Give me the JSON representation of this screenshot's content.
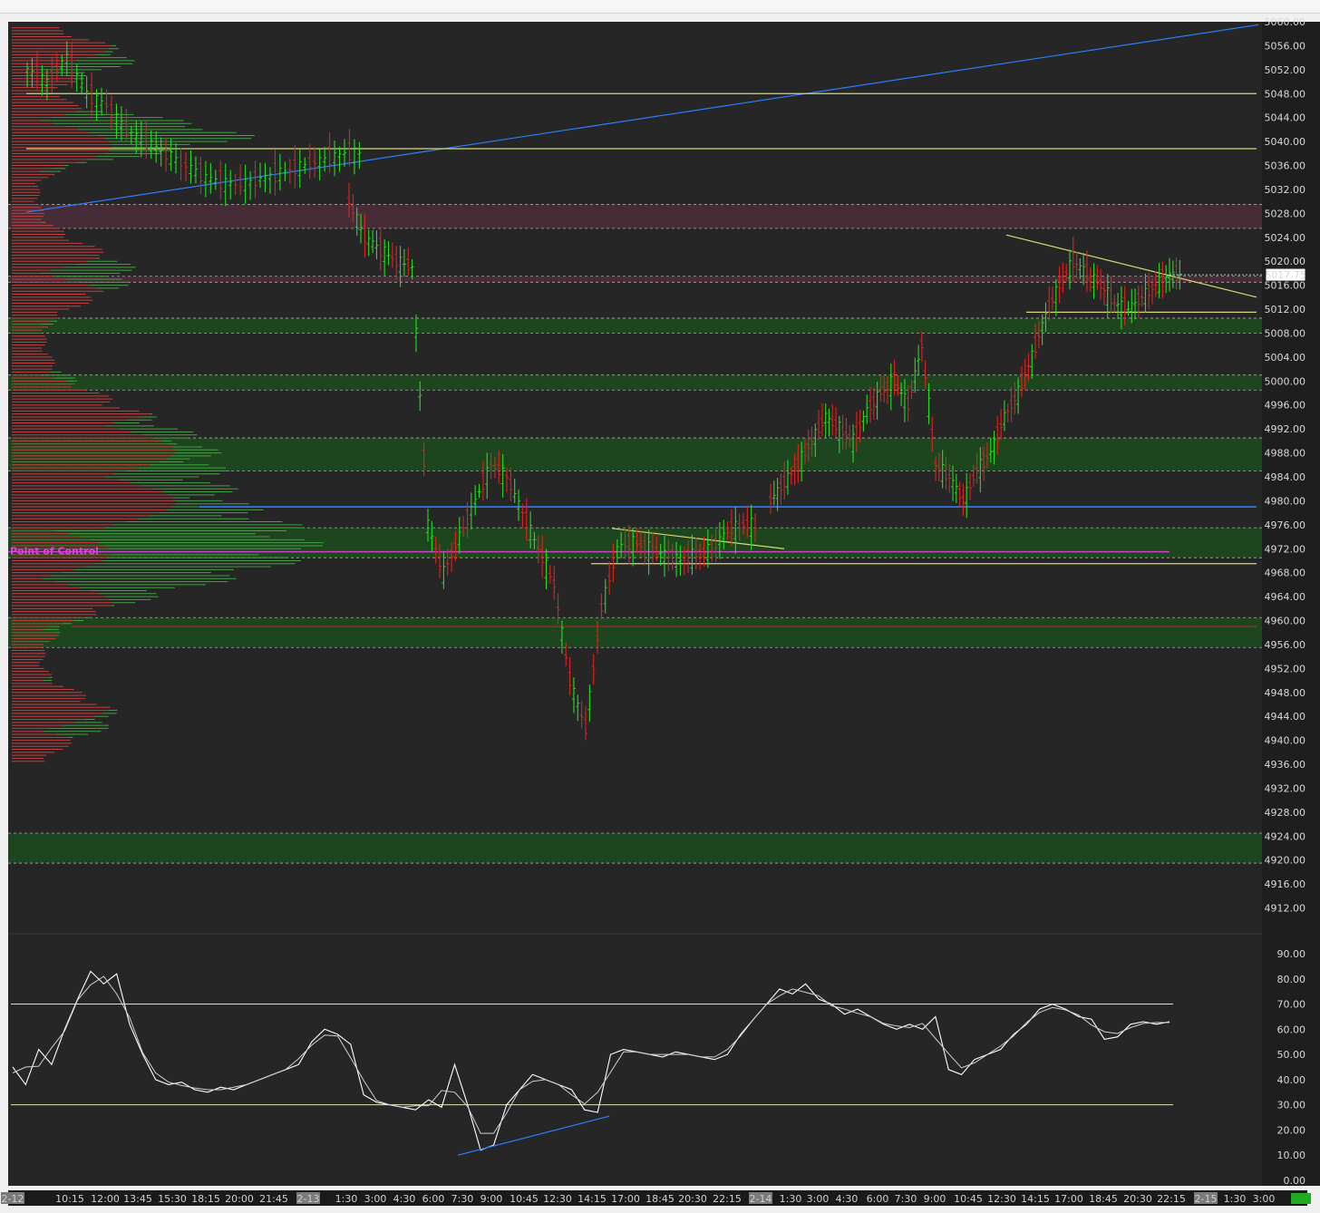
{
  "window": {
    "title": ""
  },
  "colors": {
    "background": "#262626",
    "up_bar": "#22dd22",
    "down_bar": "#dd2222",
    "zone_green": "#1e4a1e",
    "zone_purple": "#4a2e3a",
    "yellow_line": "#d8d870",
    "blue_line": "#2a7fff",
    "poc_line": "#cc44cc",
    "red_level": "#bb2222"
  },
  "chart_data": [
    {
      "type": "line",
      "name": "price-panel",
      "title": "",
      "ylim": [
        4908,
        5060
      ],
      "y_ticks": [
        "5060.00",
        "5056.00",
        "5052.00",
        "5048.00",
        "5044.00",
        "5040.00",
        "5036.00",
        "5032.00",
        "5028.00",
        "5024.00",
        "5020.00",
        "5016.00",
        "5012.00",
        "5008.00",
        "5004.00",
        "5000.00",
        "4996.00",
        "4992.00",
        "4988.00",
        "4984.00",
        "4980.00",
        "4976.00",
        "4972.00",
        "4968.00",
        "4964.00",
        "4960.00",
        "4956.00",
        "4952.00",
        "4948.00",
        "4944.00",
        "4940.00",
        "4936.00",
        "4932.00",
        "4928.00",
        "4924.00",
        "4920.00",
        "4916.00",
        "4912.00"
      ],
      "last_price": "5017.75",
      "poc_label": "Point of Control",
      "poc_price": 4971.5,
      "x_labels": [
        "2-12",
        "10:15",
        "12:00",
        "13:45",
        "15:30",
        "18:15",
        "20:00",
        "21:45",
        "2-13",
        "1:30",
        "3:00",
        "4:30",
        "6:00",
        "7:30",
        "9:00",
        "10:45",
        "12:30",
        "14:15",
        "17:00",
        "18:45",
        "20:30",
        "22:15",
        "2-14",
        "1:30",
        "3:00",
        "4:30",
        "6:00",
        "7:30",
        "9:00",
        "10:45",
        "12:30",
        "14:15",
        "17:00",
        "18:45",
        "20:30",
        "22:15",
        "2-15",
        "1:30",
        "3:00"
      ],
      "zones": [
        {
          "from": 5025.5,
          "to": 5029.5,
          "kind": "purple"
        },
        {
          "from": 5016.5,
          "to": 5017.5,
          "kind": "purple"
        },
        {
          "from": 5008.0,
          "to": 5010.5,
          "kind": "green"
        },
        {
          "from": 4998.5,
          "to": 5001.0,
          "kind": "green"
        },
        {
          "from": 4985.0,
          "to": 4990.5,
          "kind": "green"
        },
        {
          "from": 4970.5,
          "to": 4975.5,
          "kind": "green"
        },
        {
          "from": 4955.5,
          "to": 4960.5,
          "kind": "green"
        },
        {
          "from": 4919.5,
          "to": 4924.5,
          "kind": "green"
        }
      ],
      "horizontal_levels": [
        {
          "price": 5048.0,
          "color": "yellow"
        },
        {
          "price": 5038.8,
          "color": "yellow"
        },
        {
          "price": 4979.0,
          "color": "blue"
        },
        {
          "price": 4969.5,
          "color": "yellow"
        },
        {
          "price": 5011.5,
          "color": "yellow"
        },
        {
          "price": 4959.0,
          "color": "red"
        }
      ],
      "series": [
        {
          "session": "2-12",
          "close": [
            5052,
            5050,
            5054,
            5048,
            5046,
            5042,
            5040,
            5038,
            5036,
            5034,
            5033,
            5033,
            5034,
            5035,
            5036,
            5037,
            5038
          ]
        },
        {
          "session": "2-13",
          "close": [
            5030,
            5024,
            5022,
            5020,
            5019,
            4976,
            4968,
            4974,
            4980,
            4986,
            4984,
            4978,
            4972,
            4966,
            4950,
            4942,
            4962,
            4972,
            4973,
            4972,
            4971,
            4970,
            4971,
            4972,
            4975,
            4976
          ]
        },
        {
          "session": "2-14",
          "close": [
            4980,
            4983,
            4986,
            4990,
            4994,
            4992,
            4990,
            4995,
            4998,
            5000,
            4996,
            5006,
            4986,
            4984,
            4980,
            4985,
            4988,
            4994,
            4998,
            5004,
            5011,
            5016,
            5020,
            5018,
            5016,
            5013,
            5012,
            5014,
            5016,
            5017.75
          ]
        }
      ]
    },
    {
      "type": "line",
      "name": "oscillator-panel",
      "ylim": [
        0,
        90
      ],
      "y_ticks": [
        "90.00",
        "80.00",
        "70.00",
        "60.00",
        "50.00",
        "40.00",
        "30.00",
        "20.00",
        "10.00",
        "0.00"
      ],
      "bands": [
        70,
        30
      ],
      "series": [
        {
          "name": "",
          "values": [
            45,
            38,
            52,
            46,
            60,
            72,
            83,
            78,
            82,
            62,
            50,
            40,
            38,
            39,
            36,
            35,
            37,
            36,
            38,
            40,
            42,
            44,
            46,
            55,
            60,
            58,
            54,
            34,
            31,
            30,
            29,
            28,
            32,
            29,
            46,
            30,
            12,
            14,
            30,
            36,
            42,
            40,
            38,
            36,
            28,
            27,
            50,
            52,
            51,
            50,
            49,
            51,
            50,
            49,
            48,
            50,
            58,
            64,
            70,
            76,
            74,
            78,
            72,
            70,
            66,
            68,
            65,
            62,
            60,
            62,
            60,
            65,
            44,
            42,
            48,
            50,
            52,
            58,
            62,
            68,
            70,
            68,
            65,
            64,
            56,
            57,
            62,
            63,
            62,
            63
          ]
        }
      ]
    }
  ]
}
